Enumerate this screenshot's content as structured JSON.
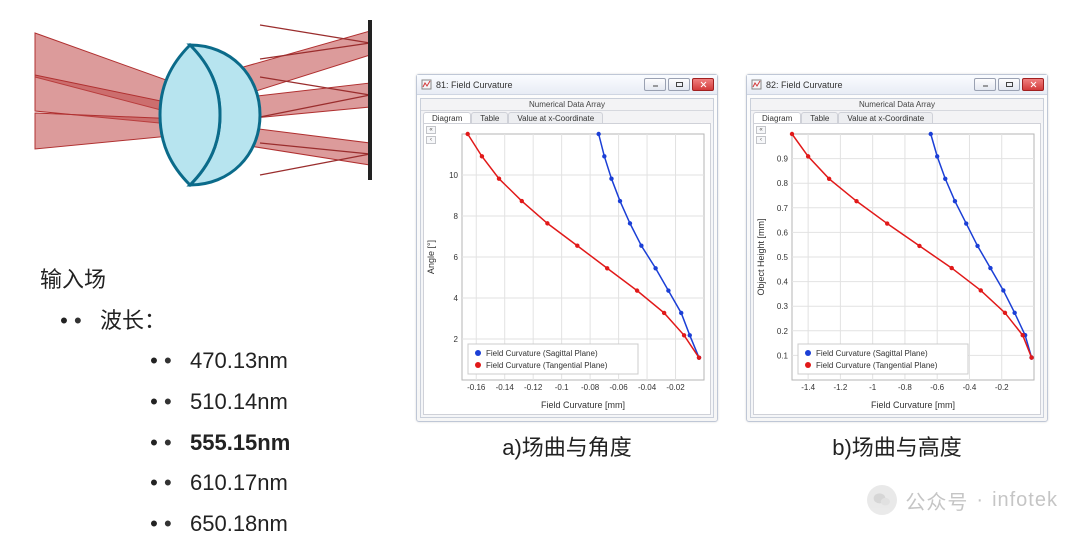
{
  "left": {
    "title": "输入场",
    "wavelength_label": "波长：",
    "wavelengths": [
      "470.13nm",
      "510.14nm",
      "555.15nm",
      "610.17nm",
      "650.18nm"
    ],
    "bold_idx": 2
  },
  "captions": {
    "a": "a)场曲与角度",
    "b": "b)场曲与高度"
  },
  "watermark": {
    "label": "公众号",
    "handle": "infotek"
  },
  "windows": {
    "common": {
      "nda_label": "Numerical Data Array",
      "tabs": [
        "Diagram",
        "Table",
        "Value at x-Coordinate"
      ],
      "legend_sag": "Field Curvature (Sagittal Plane)",
      "legend_tan": "Field Curvature (Tangential Plane)",
      "xlabel": "Field Curvature [mm]"
    },
    "a": {
      "title": "81: Field Curvature",
      "ylabel": "Angle [°]"
    },
    "b": {
      "title": "82: Field Curvature",
      "ylabel": "Object Height [mm]"
    }
  },
  "chart_data": [
    {
      "name": "angle_vs_field_curvature",
      "type": "line",
      "title": "",
      "xlabel": "Field Curvature [mm]",
      "ylabel": "Angle [°]",
      "xlim": [
        -0.17,
        0.0
      ],
      "ylim": [
        0,
        12
      ],
      "xticks": [
        -0.16,
        -0.14,
        -0.12,
        -0.1,
        -0.08,
        -0.06,
        -0.04,
        -0.02
      ],
      "yticks": [
        2,
        4,
        6,
        8,
        10
      ],
      "series": [
        {
          "name": "Sagittal Plane",
          "color": "#1b3fd6",
          "x": [
            -0.0035,
            -0.01,
            -0.016,
            -0.025,
            -0.034,
            -0.044,
            -0.052,
            -0.059,
            -0.065,
            -0.07,
            -0.074
          ],
          "y": [
            1.09,
            2.18,
            3.27,
            4.36,
            5.45,
            6.55,
            7.64,
            8.73,
            9.82,
            10.91,
            12.0
          ]
        },
        {
          "name": "Tangential Plane",
          "color": "#e11919",
          "x": [
            -0.0035,
            -0.014,
            -0.028,
            -0.047,
            -0.068,
            -0.089,
            -0.11,
            -0.128,
            -0.144,
            -0.156,
            -0.166
          ],
          "y": [
            1.09,
            2.18,
            3.27,
            4.36,
            5.45,
            6.55,
            7.64,
            8.73,
            9.82,
            10.91,
            12.0
          ]
        }
      ]
    },
    {
      "name": "height_vs_field_curvature",
      "type": "line",
      "title": "",
      "xlabel": "Field Curvature [mm]",
      "ylabel": "Object Height [mm]",
      "xlim": [
        -1.5,
        0.0
      ],
      "ylim": [
        0,
        1.0
      ],
      "xticks": [
        -1.4,
        -1.2,
        -1.0,
        -0.8,
        -0.6,
        -0.4,
        -0.2
      ],
      "yticks": [
        0.1,
        0.2,
        0.3,
        0.4,
        0.5,
        0.6,
        0.7,
        0.8,
        0.9
      ],
      "series": [
        {
          "name": "Sagittal Plane",
          "color": "#1b3fd6",
          "x": [
            -0.015,
            -0.055,
            -0.12,
            -0.19,
            -0.27,
            -0.35,
            -0.42,
            -0.49,
            -0.55,
            -0.6,
            -0.64
          ],
          "y": [
            0.091,
            0.182,
            0.273,
            0.364,
            0.455,
            0.545,
            0.636,
            0.727,
            0.818,
            0.909,
            1.0
          ]
        },
        {
          "name": "Tangential Plane",
          "color": "#e11919",
          "x": [
            -0.015,
            -0.07,
            -0.18,
            -0.33,
            -0.51,
            -0.71,
            -0.91,
            -1.1,
            -1.27,
            -1.4,
            -1.5
          ],
          "y": [
            0.091,
            0.182,
            0.273,
            0.364,
            0.455,
            0.545,
            0.636,
            0.727,
            0.818,
            0.909,
            1.0
          ]
        }
      ]
    }
  ]
}
